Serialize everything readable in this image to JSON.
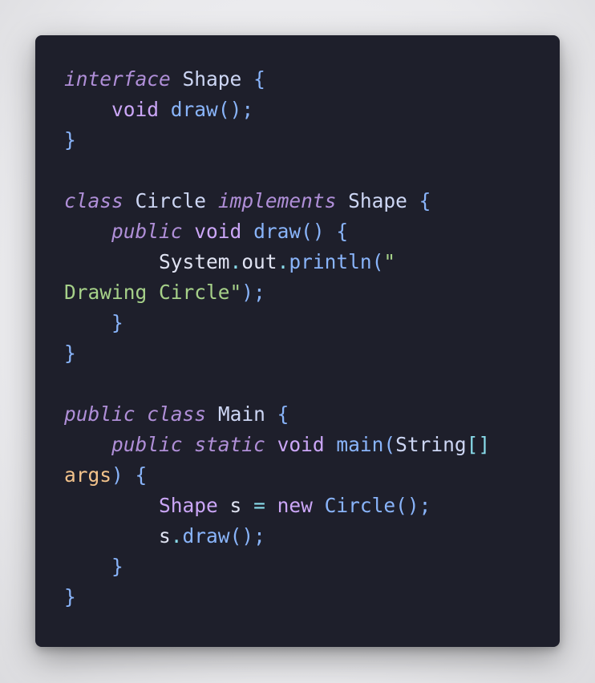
{
  "code": {
    "l1": {
      "kw": "interface",
      "name": "Shape",
      "brace": "{"
    },
    "l2": {
      "kw": "void",
      "fn": "draw",
      "rest": "();"
    },
    "l3": {
      "brace": "}"
    },
    "l5": {
      "kw": "class",
      "name": "Circle",
      "kw2": "implements",
      "iface": "Shape",
      "brace": "{"
    },
    "l6": {
      "kw": "public",
      "kw2": "void",
      "fn": "draw",
      "rest": "() {"
    },
    "l7": {
      "obj": "System",
      "dot1": ".",
      "field": "out",
      "dot2": ".",
      "fn": "println",
      "open": "(",
      "str": "\""
    },
    "l8": {
      "str": "Drawing Circle\"",
      "rest": ");"
    },
    "l9": {
      "brace": "}"
    },
    "l10": {
      "brace": "}"
    },
    "l12": {
      "kw": "public",
      "kw2": "class",
      "name": "Main",
      "brace": "{"
    },
    "l13": {
      "kw": "public",
      "kw2": "static",
      "kw3": "void",
      "fn": "main",
      "open": "(",
      "type": "String",
      "brackets": "[]"
    },
    "l14": {
      "param": "args",
      "rest": ") {"
    },
    "l15": {
      "type": "Shape",
      "var": "s",
      "eq": "=",
      "kw": "new",
      "ctor": "Circle",
      "rest": "();"
    },
    "l16": {
      "var": "s",
      "dot": ".",
      "fn": "draw",
      "rest": "();"
    },
    "l17": {
      "brace": "}"
    },
    "l18": {
      "brace": "}"
    }
  }
}
